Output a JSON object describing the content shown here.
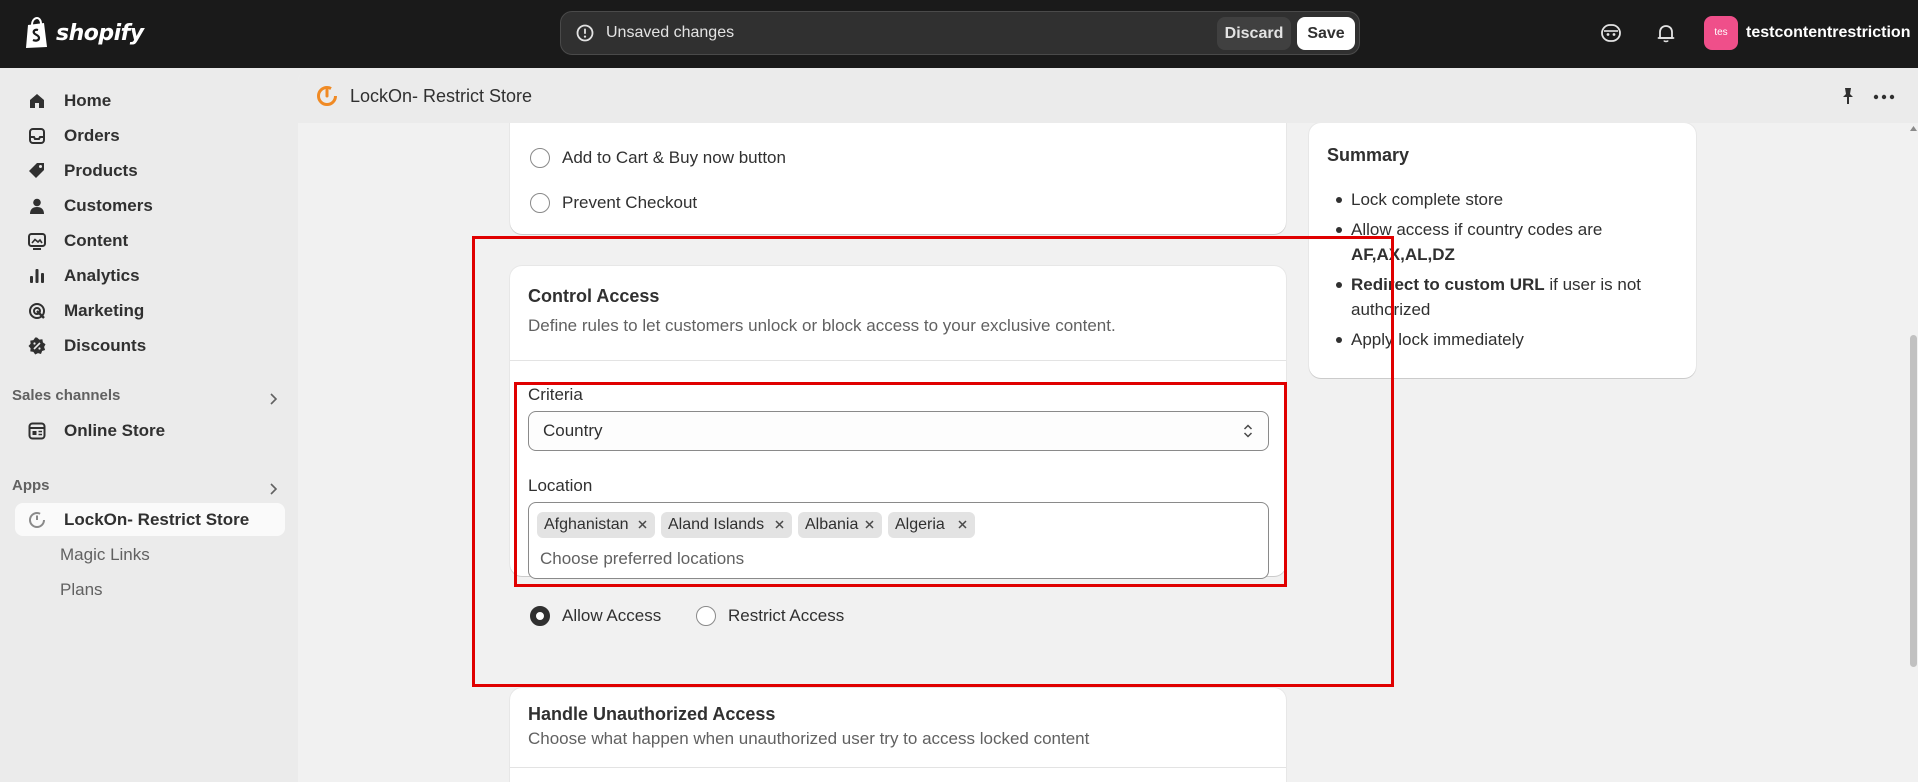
{
  "topbar": {
    "brand": "shopify",
    "unsaved_text": "Unsaved changes",
    "discard_label": "Discard",
    "save_label": "Save",
    "avatar_text": "tes",
    "account_name": "testcontentrestriction",
    "avatar_color": "#ef4f8a"
  },
  "sidebar": {
    "items": [
      {
        "label": "Home",
        "icon": "home-icon"
      },
      {
        "label": "Orders",
        "icon": "inbox-icon"
      },
      {
        "label": "Products",
        "icon": "tag-icon"
      },
      {
        "label": "Customers",
        "icon": "person-icon"
      },
      {
        "label": "Content",
        "icon": "image-icon"
      },
      {
        "label": "Analytics",
        "icon": "bar-chart-icon"
      },
      {
        "label": "Marketing",
        "icon": "target-icon"
      },
      {
        "label": "Discounts",
        "icon": "discount-icon"
      }
    ],
    "sales_channels_header": "Sales channels",
    "online_store": "Online Store",
    "apps_header": "Apps",
    "app_name": "LockOn- Restrict Store",
    "app_sub_items": [
      "Magic Links",
      "Plans"
    ]
  },
  "header": {
    "title": "LockOn- Restrict Store"
  },
  "lock_options_card": {
    "options": [
      "Add to Cart & Buy now button",
      "Prevent Checkout"
    ]
  },
  "control_access": {
    "title": "Control Access",
    "description": "Define rules to let customers unlock or block access to your exclusive content.",
    "criteria_label": "Criteria",
    "criteria_value": "Country",
    "location_label": "Location",
    "locations": [
      "Afghanistan",
      "Aland Islands",
      "Albania",
      "Algeria"
    ],
    "location_placeholder": "Choose preferred locations",
    "allow_label": "Allow Access",
    "restrict_label": "Restrict Access",
    "selected_access": "Allow Access"
  },
  "unauthorized": {
    "title": "Handle Unauthorized Access",
    "description": "Choose what happen when unauthorized user try to access locked content"
  },
  "summary": {
    "title": "Summary",
    "item1": "Lock complete store",
    "item2_prefix": "Allow access if country codes are ",
    "item2_bold": "AF,AX,AL,DZ",
    "item3_bold": "Redirect to custom URL",
    "item3_suffix": " if user is not authorized",
    "item4": "Apply lock immediately"
  },
  "annotation_color": "#e00000"
}
